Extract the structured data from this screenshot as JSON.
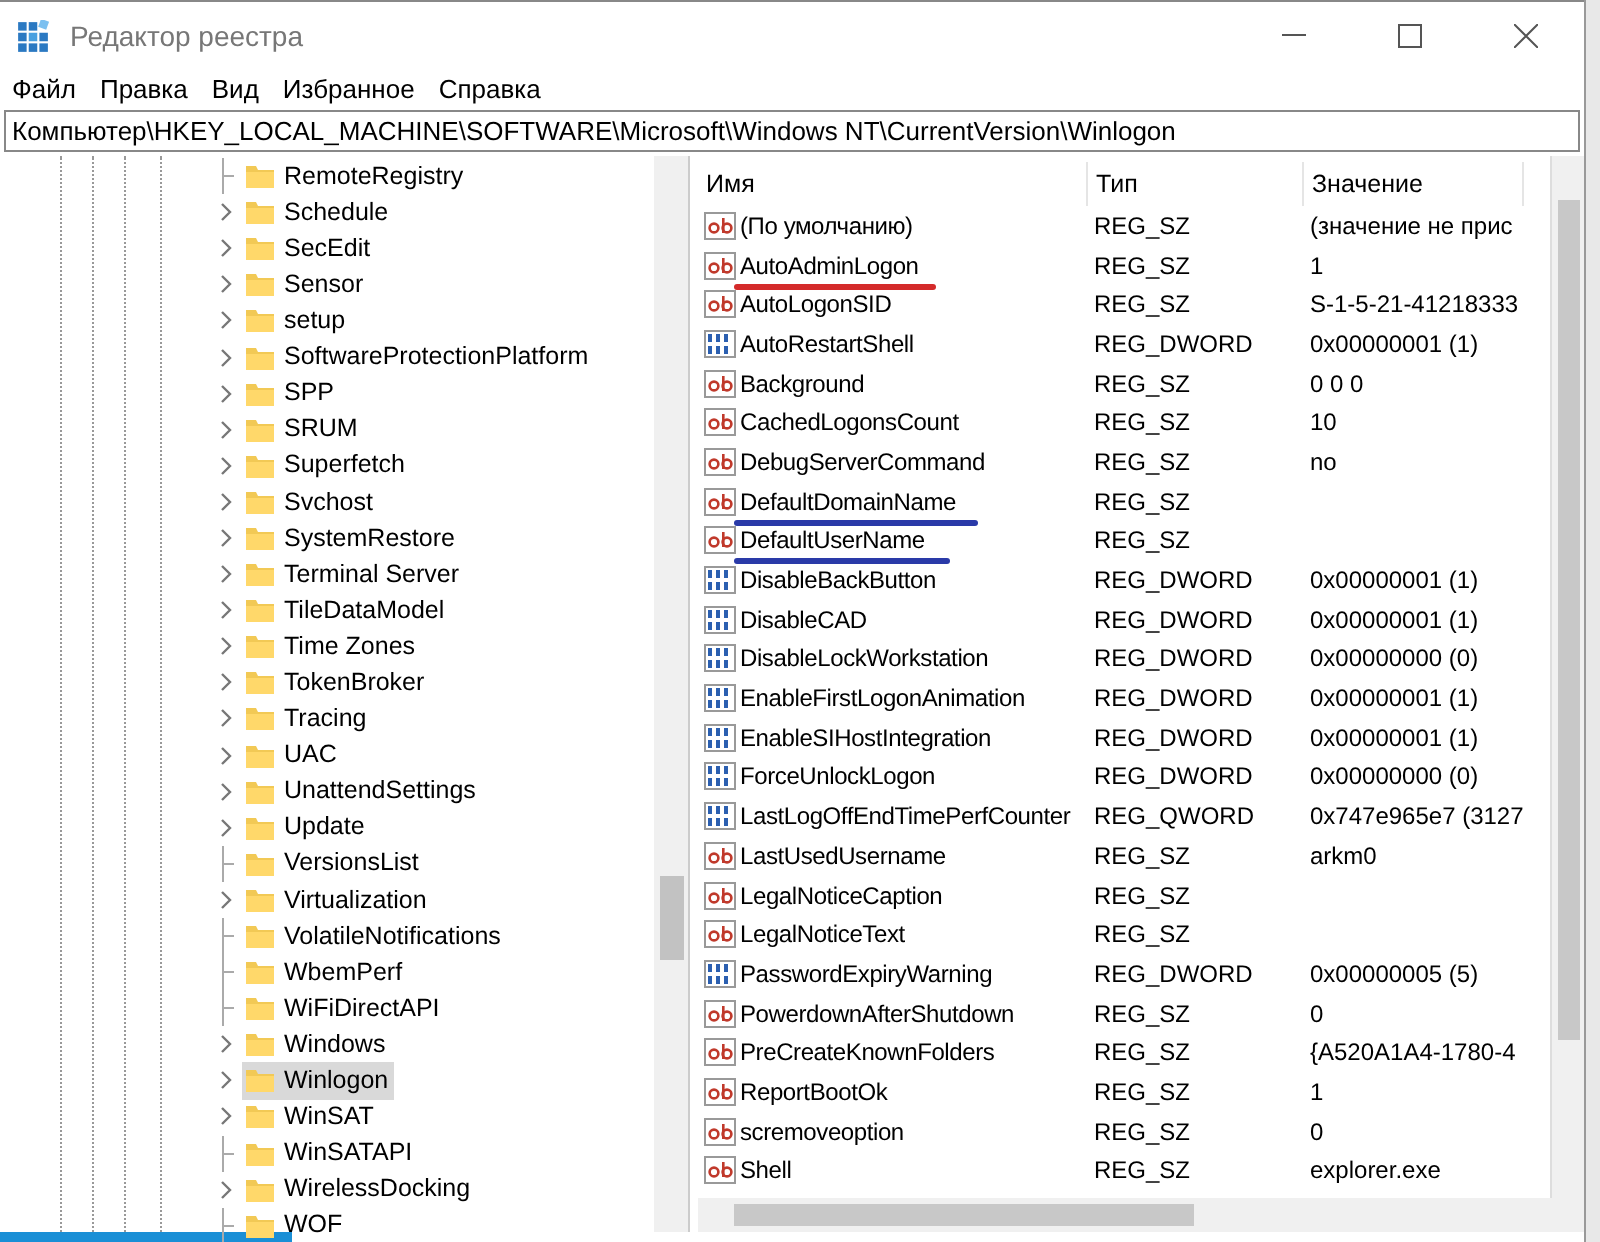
{
  "window": {
    "title": "Редактор реестра"
  },
  "menu": [
    "Файл",
    "Правка",
    "Вид",
    "Избранное",
    "Справка"
  ],
  "address": "Компьютер\\HKEY_LOCAL_MACHINE\\SOFTWARE\\Microsoft\\Windows NT\\CurrentVersion\\Winlogon",
  "tree": {
    "items": [
      {
        "label": "RemoteRegistry",
        "has_children": false,
        "selected": false
      },
      {
        "label": "Schedule",
        "has_children": true,
        "selected": false
      },
      {
        "label": "SecEdit",
        "has_children": true,
        "selected": false
      },
      {
        "label": "Sensor",
        "has_children": true,
        "selected": false
      },
      {
        "label": "setup",
        "has_children": true,
        "selected": false
      },
      {
        "label": "SoftwareProtectionPlatform",
        "has_children": true,
        "selected": false
      },
      {
        "label": "SPP",
        "has_children": true,
        "selected": false
      },
      {
        "label": "SRUM",
        "has_children": true,
        "selected": false
      },
      {
        "label": "Superfetch",
        "has_children": true,
        "selected": false
      },
      {
        "label": "Svchost",
        "has_children": true,
        "selected": false
      },
      {
        "label": "SystemRestore",
        "has_children": true,
        "selected": false
      },
      {
        "label": "Terminal Server",
        "has_children": true,
        "selected": false
      },
      {
        "label": "TileDataModel",
        "has_children": true,
        "selected": false
      },
      {
        "label": "Time Zones",
        "has_children": true,
        "selected": false
      },
      {
        "label": "TokenBroker",
        "has_children": true,
        "selected": false
      },
      {
        "label": "Tracing",
        "has_children": true,
        "selected": false
      },
      {
        "label": "UAC",
        "has_children": true,
        "selected": false
      },
      {
        "label": "UnattendSettings",
        "has_children": true,
        "selected": false
      },
      {
        "label": "Update",
        "has_children": true,
        "selected": false
      },
      {
        "label": "VersionsList",
        "has_children": false,
        "selected": false
      },
      {
        "label": "Virtualization",
        "has_children": true,
        "selected": false
      },
      {
        "label": "VolatileNotifications",
        "has_children": false,
        "selected": false
      },
      {
        "label": "WbemPerf",
        "has_children": false,
        "selected": false
      },
      {
        "label": "WiFiDirectAPI",
        "has_children": false,
        "selected": false
      },
      {
        "label": "Windows",
        "has_children": true,
        "selected": false
      },
      {
        "label": "Winlogon",
        "has_children": true,
        "selected": true
      },
      {
        "label": "WinSAT",
        "has_children": true,
        "selected": false
      },
      {
        "label": "WinSATAPI",
        "has_children": false,
        "selected": false
      },
      {
        "label": "WirelessDocking",
        "has_children": true,
        "selected": false
      },
      {
        "label": "WOF",
        "has_children": false,
        "selected": false
      }
    ]
  },
  "table": {
    "columns": [
      "Имя",
      "Тип",
      "Значение"
    ],
    "rows": [
      {
        "kind": "string",
        "name": "(По умолчанию)",
        "type": "REG_SZ",
        "value": "(значение не прис"
      },
      {
        "kind": "string",
        "name": "AutoAdminLogon",
        "type": "REG_SZ",
        "value": "1",
        "color": "#d42a2a"
      },
      {
        "kind": "string",
        "name": "AutoLogonSID",
        "type": "REG_SZ",
        "value": "S-1-5-21-41218333"
      },
      {
        "kind": "binary",
        "name": "AutoRestartShell",
        "type": "REG_DWORD",
        "value": "0x00000001 (1)"
      },
      {
        "kind": "string",
        "name": "Background",
        "type": "REG_SZ",
        "value": "0 0 0"
      },
      {
        "kind": "string",
        "name": "CachedLogonsCount",
        "type": "REG_SZ",
        "value": "10"
      },
      {
        "kind": "string",
        "name": "DebugServerCommand",
        "type": "REG_SZ",
        "value": "no"
      },
      {
        "kind": "string",
        "name": "DefaultDomainName",
        "type": "REG_SZ",
        "color": "#2a3aa8"
      },
      {
        "kind": "string",
        "name": "DefaultUserName",
        "type": "REG_SZ",
        "color": "#2a3aa8"
      },
      {
        "kind": "binary",
        "name": "DisableBackButton",
        "type": "REG_DWORD",
        "value": "0x00000001 (1)"
      },
      {
        "kind": "binary",
        "name": "DisableCAD",
        "type": "REG_DWORD",
        "value": "0x00000001 (1)"
      },
      {
        "kind": "binary",
        "name": "DisableLockWorkstation",
        "type": "REG_DWORD",
        "value": "0x00000000 (0)"
      },
      {
        "kind": "binary",
        "name": "EnableFirstLogonAnimation",
        "type": "REG_DWORD",
        "value": "0x00000001 (1)"
      },
      {
        "kind": "binary",
        "name": "EnableSIHostIntegration",
        "type": "REG_DWORD",
        "value": "0x00000001 (1)"
      },
      {
        "kind": "binary",
        "name": "ForceUnlockLogon",
        "type": "REG_DWORD",
        "value": "0x00000000 (0)"
      },
      {
        "kind": "binary",
        "name": "LastLogOffEndTimePerfCounter",
        "type": "REG_QWORD",
        "value": "0x747e965e7 (3127"
      },
      {
        "kind": "string",
        "name": "LastUsedUsername",
        "type": "REG_SZ",
        "value": "arkm0"
      },
      {
        "kind": "string",
        "name": "LegalNoticeCaption",
        "type": "REG_SZ"
      },
      {
        "kind": "string",
        "name": "LegalNoticeText",
        "type": "REG_SZ"
      },
      {
        "kind": "binary",
        "name": "PasswordExpiryWarning",
        "type": "REG_DWORD",
        "value": "0x00000005 (5)"
      },
      {
        "kind": "string",
        "name": "PowerdownAfterShutdown",
        "type": "REG_SZ",
        "value": "0"
      },
      {
        "kind": "string",
        "name": "PreCreateKnownFolders",
        "type": "REG_SZ",
        "value": "{A520A1A4-1780-4"
      },
      {
        "kind": "string",
        "name": "ReportBootOk",
        "type": "REG_SZ",
        "value": "1"
      },
      {
        "kind": "string",
        "name": "scremoveoption",
        "type": "REG_SZ",
        "value": "0"
      },
      {
        "kind": "string",
        "name": "Shell",
        "type": "REG_SZ",
        "value": "explorer.exe"
      }
    ]
  }
}
